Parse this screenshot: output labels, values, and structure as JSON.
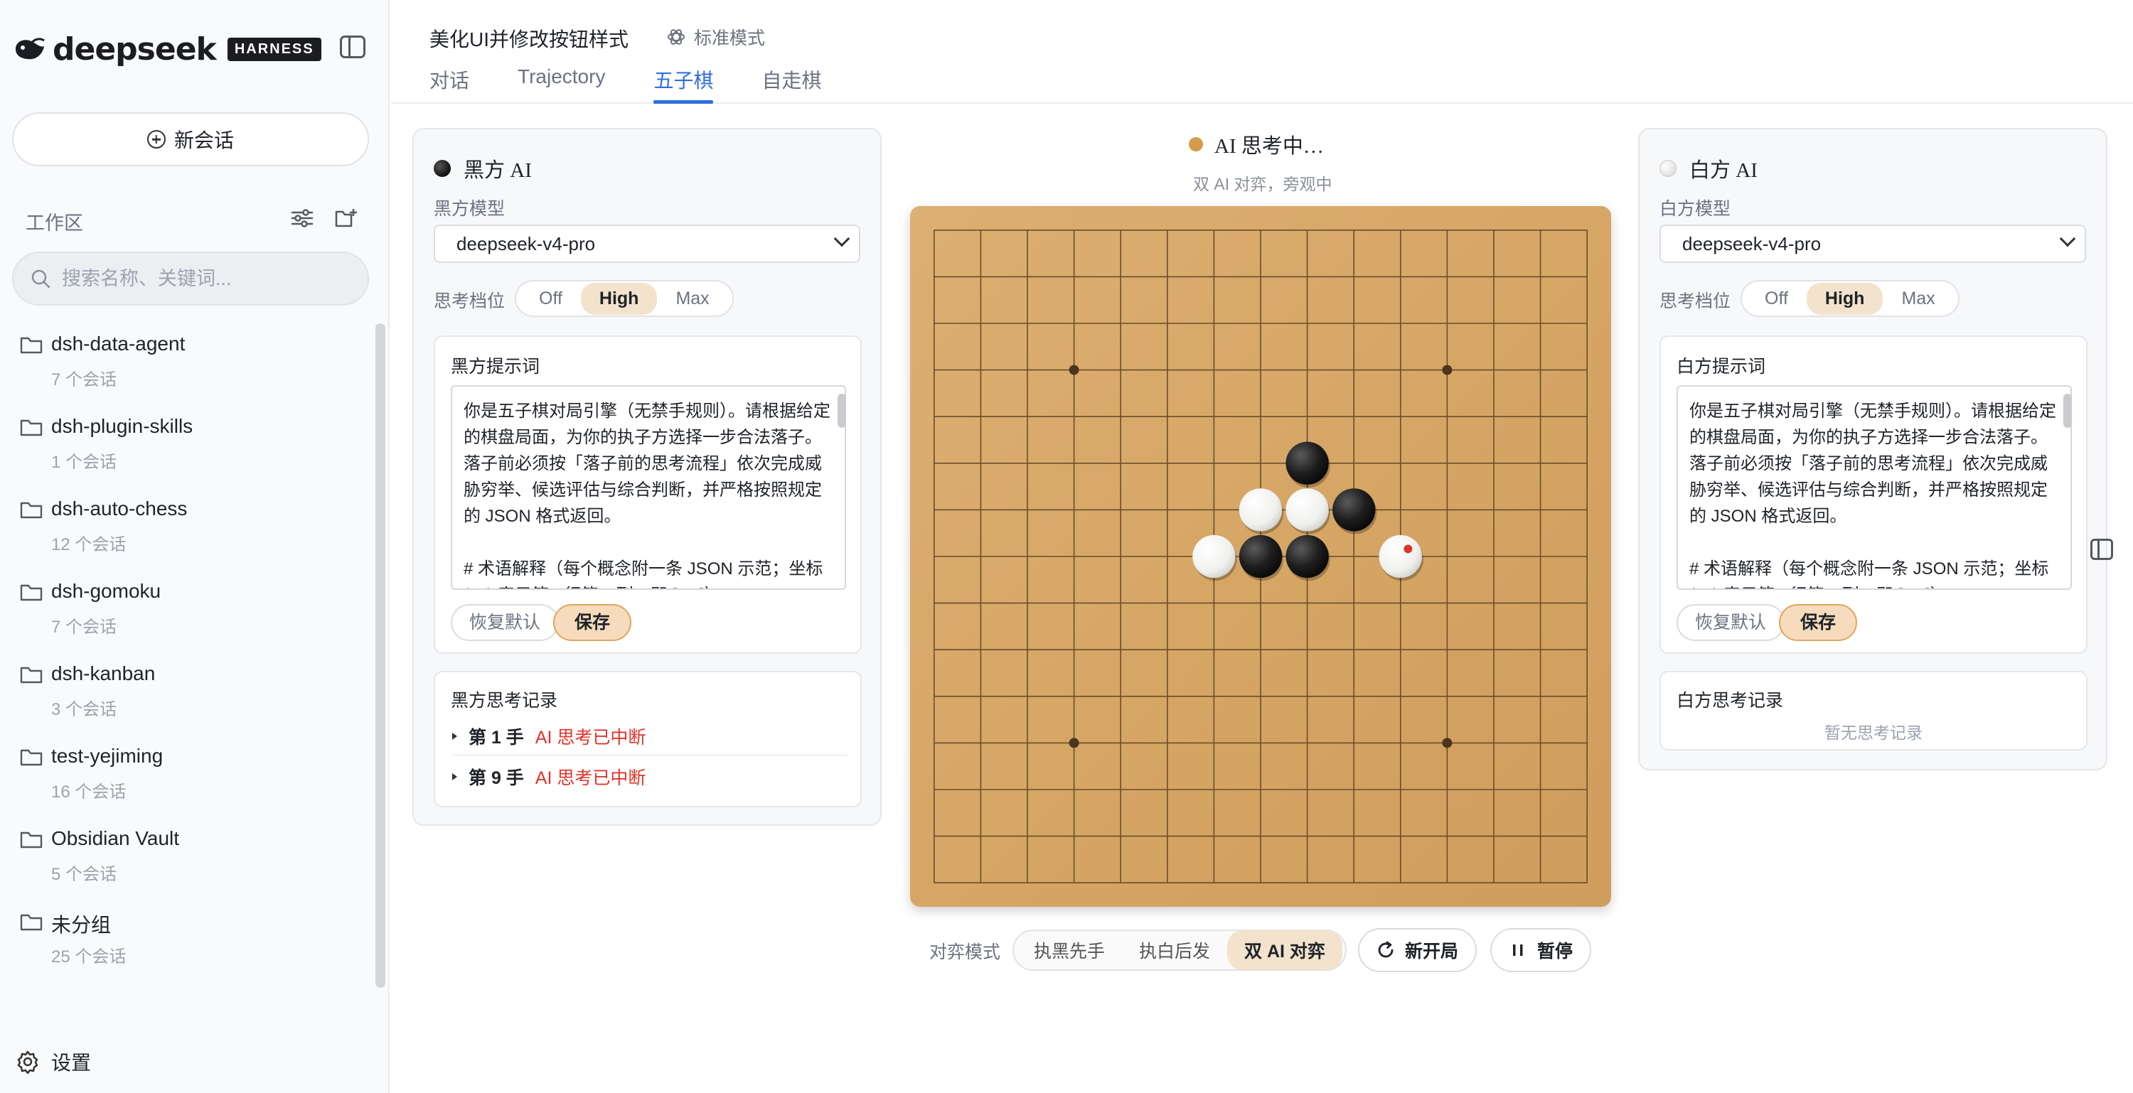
{
  "sidebar": {
    "brand": "deepseek",
    "brand_tag": "HARNESS",
    "new_chat_label": "新会话",
    "workspace_label": "工作区",
    "search_placeholder": "搜索名称、关键词...",
    "folders": [
      {
        "name": "dsh-data-agent",
        "count": "7 个会话"
      },
      {
        "name": "dsh-plugin-skills",
        "count": "1 个会话"
      },
      {
        "name": "dsh-auto-chess",
        "count": "12 个会话"
      },
      {
        "name": "dsh-gomoku",
        "count": "7 个会话"
      },
      {
        "name": "dsh-kanban",
        "count": "3 个会话"
      },
      {
        "name": "test-yejiming",
        "count": "16 个会话"
      },
      {
        "name": "Obsidian Vault",
        "count": "5 个会话"
      },
      {
        "name": "未分组",
        "count": "25 个会话"
      }
    ],
    "settings_label": "设置"
  },
  "header": {
    "title": "美化UI并修改按钮样式",
    "mode": "标准模式",
    "tabs": [
      {
        "label": "对话"
      },
      {
        "label": "Trajectory"
      },
      {
        "label": "五子棋"
      },
      {
        "label": "自走棋"
      }
    ],
    "active_tab": "五子棋"
  },
  "black_panel": {
    "title": "黑方 AI",
    "model_label": "黑方模型",
    "model_value": "deepseek-v4-pro",
    "think_label": "思考档位",
    "think_options": [
      "Off",
      "High",
      "Max"
    ],
    "think_selected": "High",
    "prompt_title": "黑方提示词",
    "prompt_text": "你是五子棋对局引擎（无禁手规则）。请根据给定的棋盘局面，为你的执子方选择一步合法落子。落子前必须按「落子前的思考流程」依次完成威胁穷举、候选评估与综合判断，并严格按照规定的 JSON 格式返回。\n\n# 术语解释（每个概念附一条 JSON 示范；坐标 (r,c) 表示第 r 行第 c 列，即 [r, c]）",
    "reset_label": "恢复默认",
    "save_label": "保存",
    "log_title": "黑方思考记录",
    "log": [
      {
        "move": "第 1 手",
        "status": "AI 思考已中断"
      },
      {
        "move": "第 9 手",
        "status": "AI 思考已中断"
      }
    ]
  },
  "white_panel": {
    "title": "白方 AI",
    "model_label": "白方模型",
    "model_value": "deepseek-v4-pro",
    "think_label": "思考档位",
    "think_options": [
      "Off",
      "High",
      "Max"
    ],
    "think_selected": "High",
    "prompt_title": "白方提示词",
    "prompt_text": "你是五子棋对局引擎（无禁手规则）。请根据给定的棋盘局面，为你的执子方选择一步合法落子。落子前必须按「落子前的思考流程」依次完成威胁穷举、候选评估与综合判断，并严格按照规定的 JSON 格式返回。\n\n# 术语解释（每个概念附一条 JSON 示范；坐标 (r,c) 表示第 r 行第 c 列，即 [r, c]）",
    "reset_label": "恢复默认",
    "save_label": "保存",
    "log_title": "白方思考记录",
    "log_empty": "暂无思考记录"
  },
  "game": {
    "status": "AI 思考中…",
    "substatus": "双 AI 对弈，旁观中",
    "board_size": 15,
    "star_points": [
      [
        3,
        3
      ],
      [
        3,
        11
      ],
      [
        11,
        3
      ],
      [
        11,
        11
      ]
    ],
    "stones": [
      {
        "row": 5,
        "col": 8,
        "color": "black"
      },
      {
        "row": 6,
        "col": 7,
        "color": "white"
      },
      {
        "row": 6,
        "col": 8,
        "color": "white"
      },
      {
        "row": 6,
        "col": 9,
        "color": "black"
      },
      {
        "row": 7,
        "col": 6,
        "color": "white"
      },
      {
        "row": 7,
        "col": 7,
        "color": "black"
      },
      {
        "row": 7,
        "col": 8,
        "color": "black"
      },
      {
        "row": 7,
        "col": 10,
        "color": "white",
        "last": true
      }
    ],
    "mode_label": "对弈模式",
    "mode_options": [
      "执黑先手",
      "执白后发",
      "双 AI 对弈"
    ],
    "mode_selected": "双 AI 对弈",
    "new_game_label": "新开局",
    "pause_label": "暂停"
  },
  "colors": {
    "accent": "#2f6fdf",
    "board": "#d9aa6a",
    "highlight": "#f3e3cd",
    "error": "#e0342a"
  }
}
